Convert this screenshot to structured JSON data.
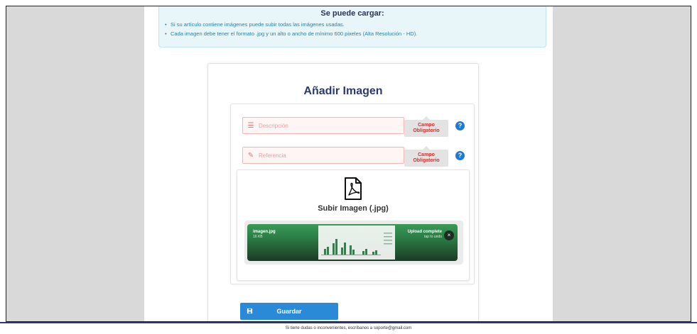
{
  "info": {
    "title": "Se puede cargar:",
    "items": [
      "Si su artículo contiene imágenes puede subir todas las imágenes usadas.",
      "Cada imagen debe tener el formato .jpg y un alto o ancho de mínimo 600 pixeles (Alta Resolución - HD)."
    ]
  },
  "form": {
    "title": "Añadir Imagen",
    "description": {
      "placeholder": "Descripción",
      "value": "",
      "required_label": "Campo Obligatorio",
      "icon": "list-icon"
    },
    "reference": {
      "placeholder": "Referencia",
      "value": "",
      "required_label": "Campo Obligatorio",
      "icon": "edit-icon"
    },
    "help_glyph": "?"
  },
  "upload": {
    "label": "Subir Imagen (.jpg)",
    "icon": "pdf-file-icon",
    "file": {
      "name": "imagen.jpg",
      "size": "16 KB",
      "status": "Upload complete",
      "undo": "tap to undo",
      "close_glyph": "×"
    }
  },
  "save": {
    "label": "Guardar",
    "icon": "save-icon"
  },
  "footer": {
    "text": "Si tiene dudas o inconvenientes, escríbanos a soporte@gmail.com"
  },
  "colors": {
    "accent": "#2a8ad8",
    "title": "#2d3a6b",
    "error": "#d32f2f",
    "success": "#3a9a58"
  }
}
